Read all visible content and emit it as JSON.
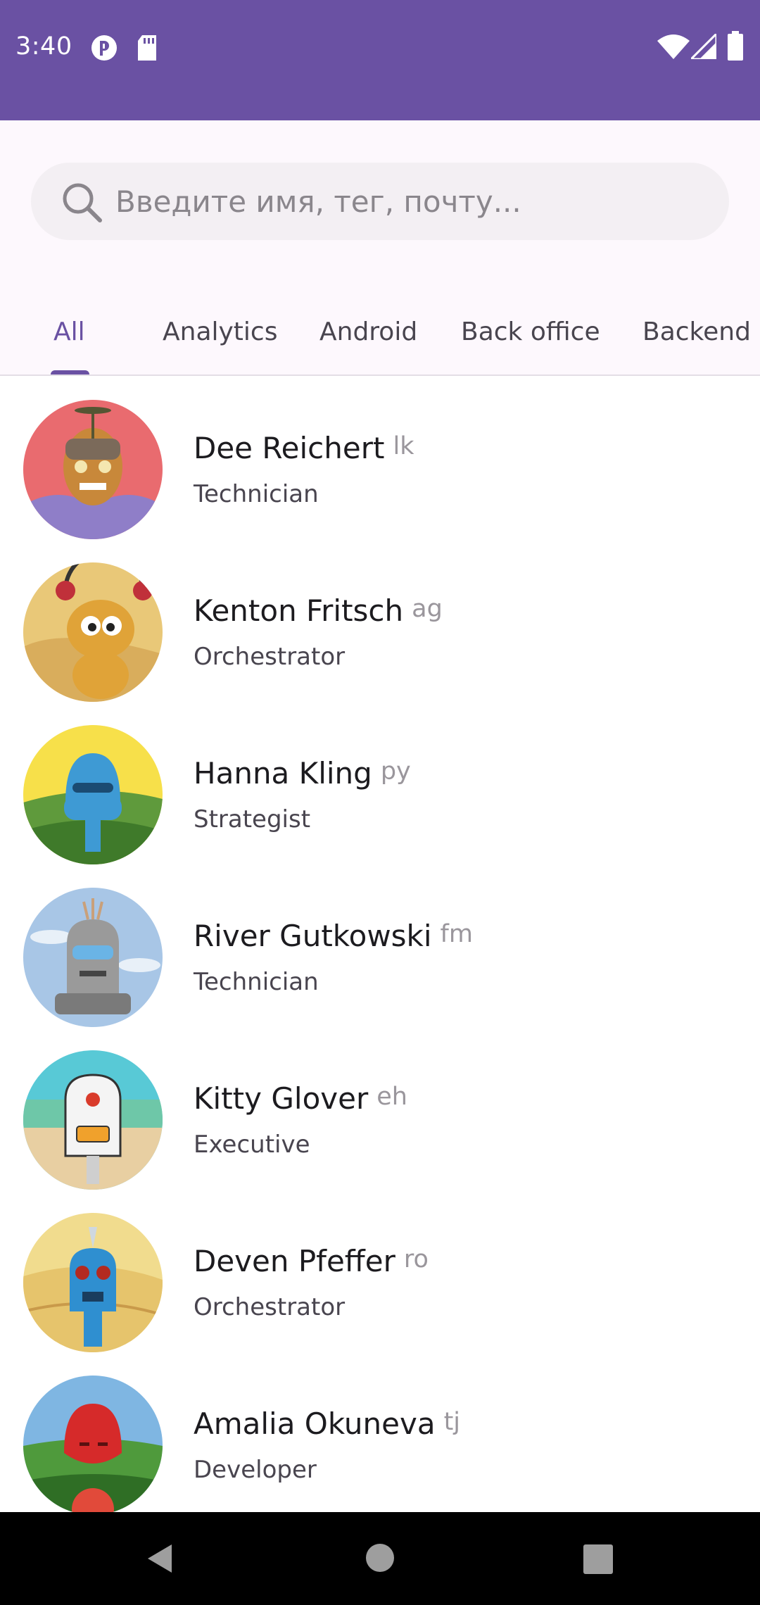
{
  "status_bar": {
    "time": "3:40",
    "icons": [
      "notification-app-icon",
      "sd-card-icon",
      "wifi-icon",
      "signal-icon",
      "battery-icon"
    ],
    "background": "#6a51a3"
  },
  "search": {
    "placeholder": "Введите имя, тег, почту...",
    "value": ""
  },
  "tabs": [
    {
      "label": "All",
      "active": true
    },
    {
      "label": "Analytics",
      "active": false
    },
    {
      "label": "Android",
      "active": false
    },
    {
      "label": "Back office",
      "active": false
    },
    {
      "label": "Backend",
      "active": false
    }
  ],
  "contacts": [
    {
      "name": "Dee Reichert",
      "tag": "lk",
      "role": "Technician"
    },
    {
      "name": "Kenton Fritsch",
      "tag": "ag",
      "role": "Orchestrator"
    },
    {
      "name": "Hanna Kling",
      "tag": "py",
      "role": "Strategist"
    },
    {
      "name": "River Gutkowski",
      "tag": "fm",
      "role": "Technician"
    },
    {
      "name": "Kitty Glover",
      "tag": "eh",
      "role": "Executive"
    },
    {
      "name": "Deven Pfeffer",
      "tag": "ro",
      "role": "Orchestrator"
    },
    {
      "name": "Amalia Okuneva",
      "tag": "tj",
      "role": "Developer"
    }
  ],
  "nav_bar": {
    "icons": [
      "back-icon",
      "home-icon",
      "recents-icon"
    ]
  },
  "colors": {
    "accent": "#6a51a3",
    "text_primary": "#1c1b1f",
    "text_secondary": "#49454f",
    "tag_text": "#9a969c"
  }
}
